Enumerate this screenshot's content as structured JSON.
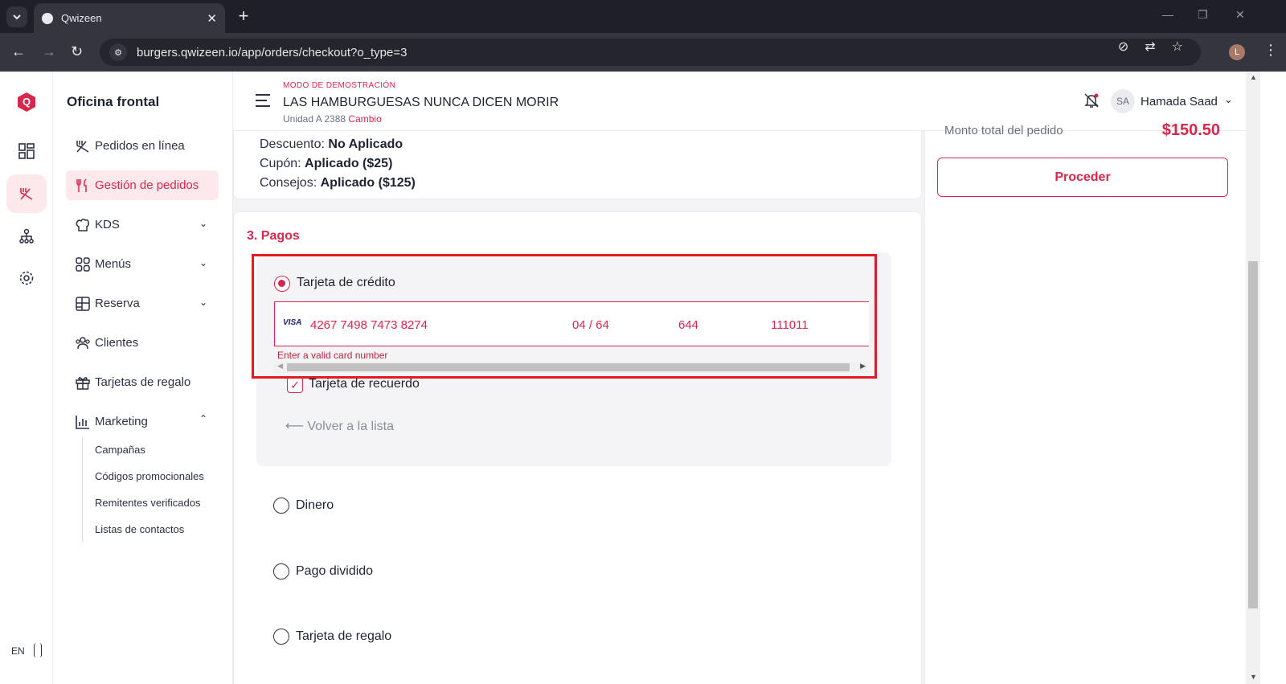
{
  "browser": {
    "tab_title": "Qwizeen",
    "url": "burgers.qwizeen.io/app/orders/checkout?o_type=3",
    "profile_initial": "L"
  },
  "app": {
    "logo_letter": "Q",
    "language": "EN"
  },
  "sidenav": {
    "title": "Oficina frontal",
    "items": [
      {
        "label": "Pedidos en línea",
        "icon": "utensils-icon"
      },
      {
        "label": "Gestión de pedidos",
        "icon": "fork-knife-icon",
        "active": true
      },
      {
        "label": "KDS",
        "icon": "chef-hat-icon",
        "expandable": true
      },
      {
        "label": "Menús",
        "icon": "grid-icon",
        "expandable": true
      },
      {
        "label": "Reserva",
        "icon": "table-icon",
        "expandable": true
      },
      {
        "label": "Clientes",
        "icon": "users-icon"
      },
      {
        "label": "Tarjetas de regalo",
        "icon": "gift-icon"
      },
      {
        "label": "Marketing",
        "icon": "bar-chart-icon",
        "expanded": true
      }
    ],
    "marketing_sub": [
      "Campañas",
      "Códigos promocionales",
      "Remitentes verificados",
      "Listas de contactos"
    ]
  },
  "header": {
    "demo_label": "MODO DE DEMOSTRACIÓN",
    "restaurant": "LAS HAMBURGUESAS NUNCA DICEN MORIR",
    "unit": "Unidad A 2388",
    "change": "Cambio",
    "user_initials": "SA",
    "user_name": "Hamada Saad"
  },
  "summary": {
    "discount_label": "Descuento:",
    "discount_value": "No Aplicado",
    "coupon_label": "Cupón:",
    "coupon_value": "Aplicado ($25)",
    "tips_label": "Consejos:",
    "tips_value": "Aplicado ($125)"
  },
  "payments": {
    "title": "3. Pagos",
    "credit_card": "Tarjeta de crédito",
    "card_brand": "VISA",
    "card_number": "4267 7498 7473 8274",
    "card_expiry": "04 / 64",
    "card_cvc": "644",
    "card_zip": "111011",
    "card_error": "Enter a valid card number",
    "remember": "Tarjeta de recuerdo",
    "back": "Volver a la lista",
    "options": [
      "Dinero",
      "Pago dividido",
      "Tarjeta de regalo"
    ]
  },
  "order": {
    "total_label": "Monto total del pedido",
    "total_value": "$150.50",
    "proceed": "Proceder"
  },
  "colors": {
    "accent": "#d6284b",
    "highlight": "#e01b24"
  }
}
